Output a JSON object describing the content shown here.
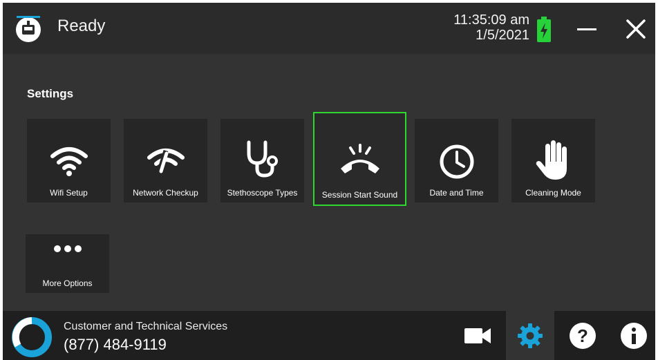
{
  "header": {
    "status": "Ready",
    "time": "11:35:09 am",
    "date": "1/5/2021"
  },
  "settings": {
    "title": "Settings",
    "tiles": [
      {
        "label": "Wifi Setup",
        "icon": "wifi-icon"
      },
      {
        "label": "Network Checkup",
        "icon": "network-checkup-icon"
      },
      {
        "label": "Stethoscope Types",
        "icon": "stethoscope-icon"
      },
      {
        "label": "Session Start Sound",
        "icon": "phone-ringing-icon",
        "selected": true
      },
      {
        "label": "Date and Time",
        "icon": "clock-icon"
      },
      {
        "label": "Cleaning Mode",
        "icon": "hand-icon"
      },
      {
        "label": "More Options",
        "icon": "more-icon"
      }
    ]
  },
  "footer": {
    "service_label": "Customer and Technical Services",
    "service_phone": "(877) 484-9119",
    "buttons": [
      "video-camera-icon",
      "settings-gear-icon",
      "help-icon",
      "info-icon"
    ],
    "active_button": "settings-gear-icon"
  },
  "colors": {
    "accent_green": "#2fd82f",
    "accent_blue": "#1aa3d9",
    "battery_green": "#27d13a"
  }
}
